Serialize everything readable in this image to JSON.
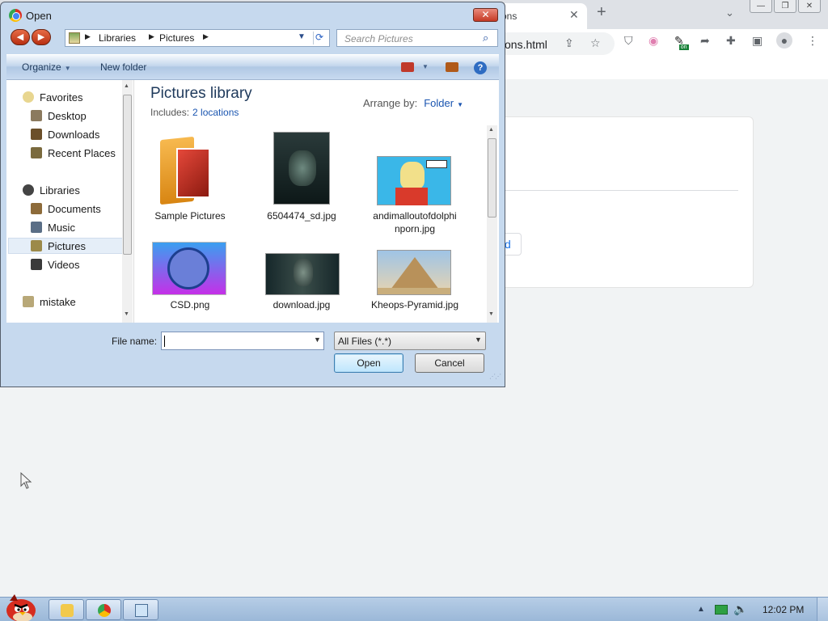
{
  "browser": {
    "tab_title": "ons",
    "tab_close": "✕",
    "new_tab": "+",
    "tab_search": "⌄",
    "window_buttons": [
      "—",
      "❐",
      "✕"
    ],
    "url": "ons.html",
    "card_button_fragment": "d",
    "extension_badge": "on"
  },
  "dialog": {
    "title": "Open",
    "close": "✕",
    "nav_back": "◀",
    "nav_forward": "▶",
    "breadcrumbs": [
      "Libraries",
      "Pictures"
    ],
    "search_placeholder": "Search Pictures",
    "toolbar": {
      "organize": "Organize",
      "new_folder": "New folder",
      "help": "?"
    },
    "nav_pane": {
      "items": [
        {
          "label": "Favorites",
          "icon": "star-icon"
        },
        {
          "label": "Desktop",
          "icon": "desktop-icon"
        },
        {
          "label": "Downloads",
          "icon": "downloads-icon"
        },
        {
          "label": "Recent Places",
          "icon": "recent-places-icon"
        },
        {
          "label": "Libraries",
          "icon": "libraries-icon"
        },
        {
          "label": "Documents",
          "icon": "documents-icon"
        },
        {
          "label": "Music",
          "icon": "music-icon"
        },
        {
          "label": "Pictures",
          "icon": "pictures-icon",
          "selected": true
        },
        {
          "label": "Videos",
          "icon": "videos-icon"
        },
        {
          "label": "mistake",
          "icon": "computer-icon"
        }
      ]
    },
    "library": {
      "title": "Pictures library",
      "includes_label": "Includes:",
      "includes_link": "2 locations",
      "arrange_label": "Arrange by:",
      "arrange_value": "Folder"
    },
    "files": [
      {
        "name": "Sample Pictures",
        "kind": "folder"
      },
      {
        "name": "6504474_sd.jpg",
        "kind": "image"
      },
      {
        "name": "andimalloutofdolphinporn.jpg",
        "kind": "image"
      },
      {
        "name": "CSD.png",
        "kind": "image"
      },
      {
        "name": "download.jpg",
        "kind": "image"
      },
      {
        "name": "Kheops-Pyramid.jpg",
        "kind": "image"
      }
    ],
    "file_name_label": "File name:",
    "file_name_value": "",
    "file_type": "All Files (*.*)",
    "open_button": "Open",
    "cancel_button": "Cancel"
  },
  "taskbar": {
    "clock": "12:02 PM",
    "tray_arrow": "▲",
    "volume": "🔈"
  },
  "colors": {
    "dialog_frame": "#c6d9ee",
    "link_blue": "#1a55b0",
    "heading_blue": "#1e395b",
    "taskbar": "#9bb8d8"
  }
}
